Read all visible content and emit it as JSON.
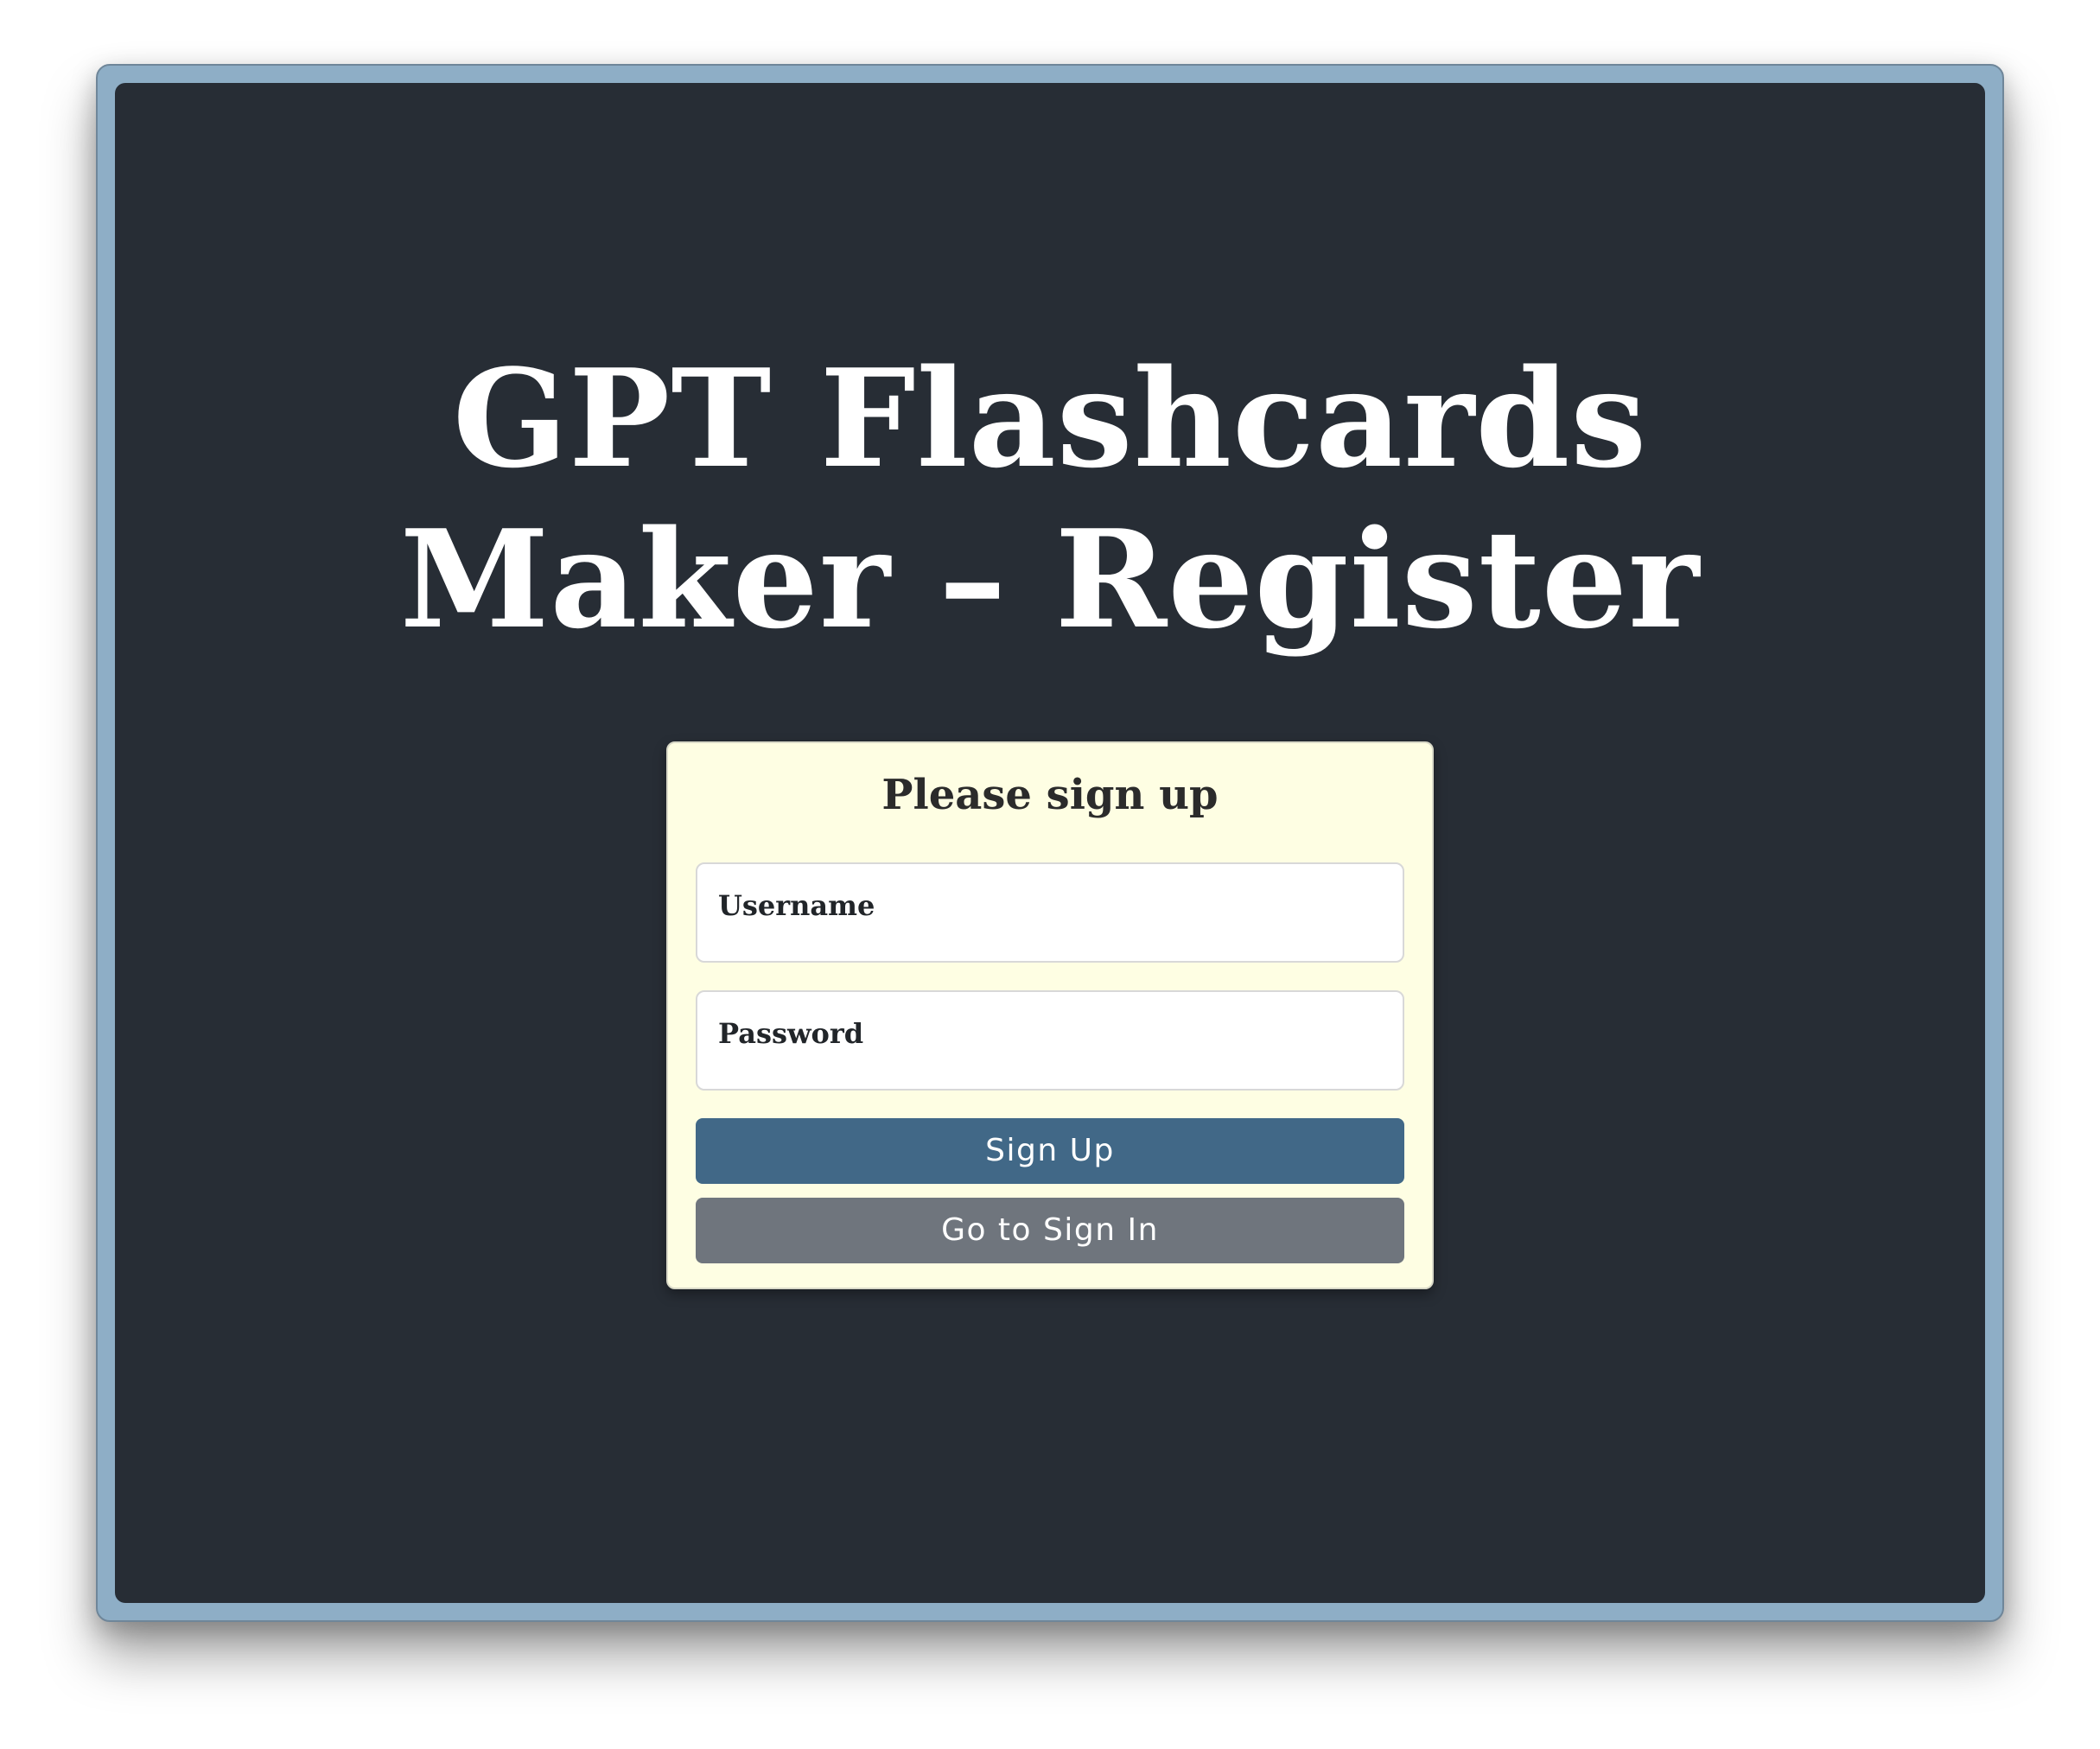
{
  "page": {
    "title": "GPT Flashcards Maker – Register"
  },
  "form": {
    "heading": "Please sign up",
    "username": {
      "label": "Username",
      "value": ""
    },
    "password": {
      "label": "Password",
      "value": ""
    },
    "signup_button": "Sign Up",
    "signin_button": "Go to Sign In"
  },
  "colors": {
    "page_background": "#272d35",
    "frame_border": "#8eaec6",
    "card_background": "#fefee3",
    "signup_button": "#416887",
    "signin_button": "#6f757d"
  }
}
